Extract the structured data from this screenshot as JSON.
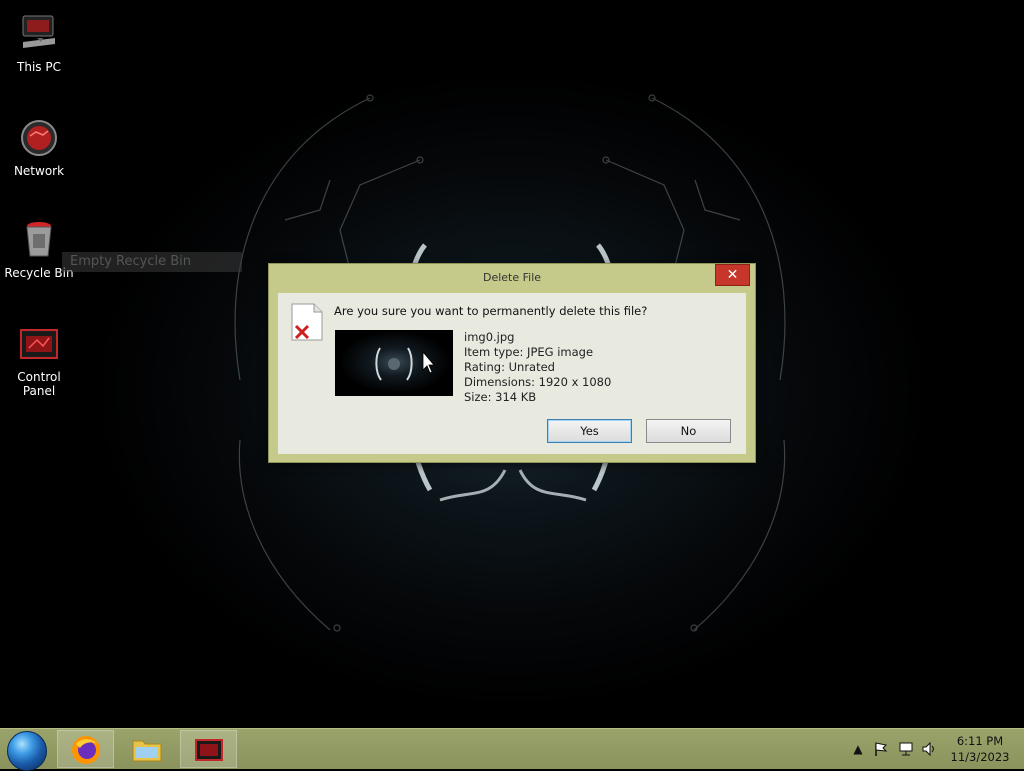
{
  "desktop": {
    "icons": [
      {
        "label": "This PC",
        "icon": "computer-icon"
      },
      {
        "label": "Network",
        "icon": "network-icon"
      },
      {
        "label": "Recycle Bin",
        "icon": "recycle-bin-icon"
      },
      {
        "label": "Control Panel",
        "icon": "control-panel-icon"
      }
    ],
    "ghost_menu_item": "Empty Recycle Bin"
  },
  "dialog": {
    "title": "Delete File",
    "close_label": "✕",
    "question": "Are you sure you want to permanently delete this file?",
    "file": {
      "name": "img0.jpg",
      "item_type": "Item type: JPEG image",
      "rating": "Rating: Unrated",
      "dimensions": "Dimensions: 1920 x 1080",
      "size": "Size: 314 KB"
    },
    "yes_label": "Yes",
    "no_label": "No"
  },
  "taskbar": {
    "apps": [
      {
        "name": "Firefox",
        "icon": "firefox-icon"
      },
      {
        "name": "File Explorer",
        "icon": "folder-icon"
      },
      {
        "name": "Control Panel",
        "icon": "control-panel-icon"
      }
    ],
    "tray": {
      "time": "6:11 PM",
      "date": "11/3/2023"
    }
  },
  "colors": {
    "taskbar": "#9aa36a",
    "dialog_frame": "#c5c98a",
    "close_button": "#c7362b"
  }
}
